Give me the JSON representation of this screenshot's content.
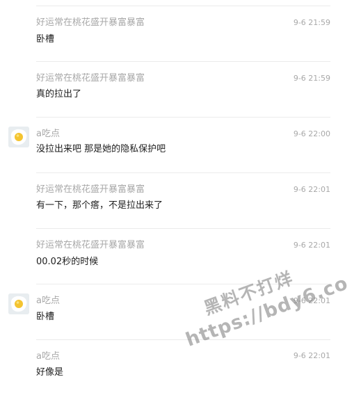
{
  "comments": [
    {
      "name": "好运常在桃花盛开暴富暴富",
      "time": "9-6 21:59",
      "text": "卧槽",
      "avatar": false
    },
    {
      "name": "好运常在桃花盛开暴富暴富",
      "time": "9-6 21:59",
      "text": "真的拉出了",
      "avatar": false
    },
    {
      "name": "a吃点",
      "time": "9-6 22:00",
      "text": "没拉出来吧 那是她的隐私保护吧",
      "avatar": true
    },
    {
      "name": "好运常在桃花盛开暴富暴富",
      "time": "9-6 22:01",
      "text": "有一下，那个瘩，不是拉出来了",
      "avatar": false
    },
    {
      "name": "好运常在桃花盛开暴富暴富",
      "time": "9-6 22:01",
      "text": "00.02秒的时候",
      "avatar": false
    },
    {
      "name": "a吃点",
      "time": "9-6 22:01",
      "text": "卧槽",
      "avatar": true
    },
    {
      "name": "a吃点",
      "time": "9-6 22:01",
      "text": "好像是",
      "avatar": false
    }
  ],
  "watermark": {
    "line1": "黑料不打烊",
    "line2": "https://bdy6.co"
  },
  "colors": {
    "name": "#a8a8a8",
    "time": "#a8a8a8",
    "text": "#1e1e1e",
    "divider": "#ebebeb"
  }
}
